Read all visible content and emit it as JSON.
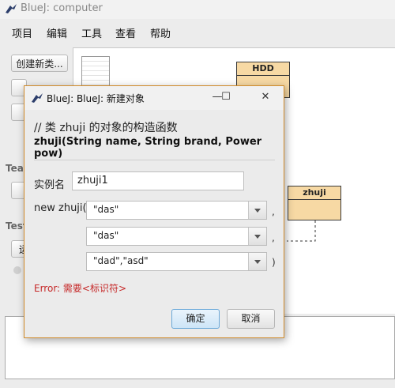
{
  "window": {
    "title": "BlueJ:  computer"
  },
  "menu": [
    "项目",
    "编辑",
    "工具",
    "查看",
    "帮助"
  ],
  "left_panel": {
    "new_class_button": "创建新类...",
    "team_label": "Tea",
    "test_label": "Test",
    "run_partial": "运"
  },
  "diagram": {
    "classes": [
      {
        "name": "HDD"
      },
      {
        "name": "zhuji"
      }
    ]
  },
  "dialog": {
    "title": "BlueJ:  BlueJ:  新建对象",
    "comment": "// 类 zhuji 的对象的构造函数",
    "signature": "zhuji(String name, String brand, Power pow)",
    "instance_label": "实例名",
    "instance_value": "zhuji1",
    "call_prefix": "new zhuji(",
    "params": [
      {
        "value": "\"das\"",
        "suffix": ","
      },
      {
        "value": "\"das\"",
        "suffix": ","
      },
      {
        "value": "\"dad\",\"asd\"",
        "suffix": ")"
      }
    ],
    "error": "Error: 需要<标识符>",
    "ok_label": "确定",
    "cancel_label": "取消",
    "controls": {
      "minimize": "—",
      "maximize": "☐",
      "close": "✕"
    }
  }
}
